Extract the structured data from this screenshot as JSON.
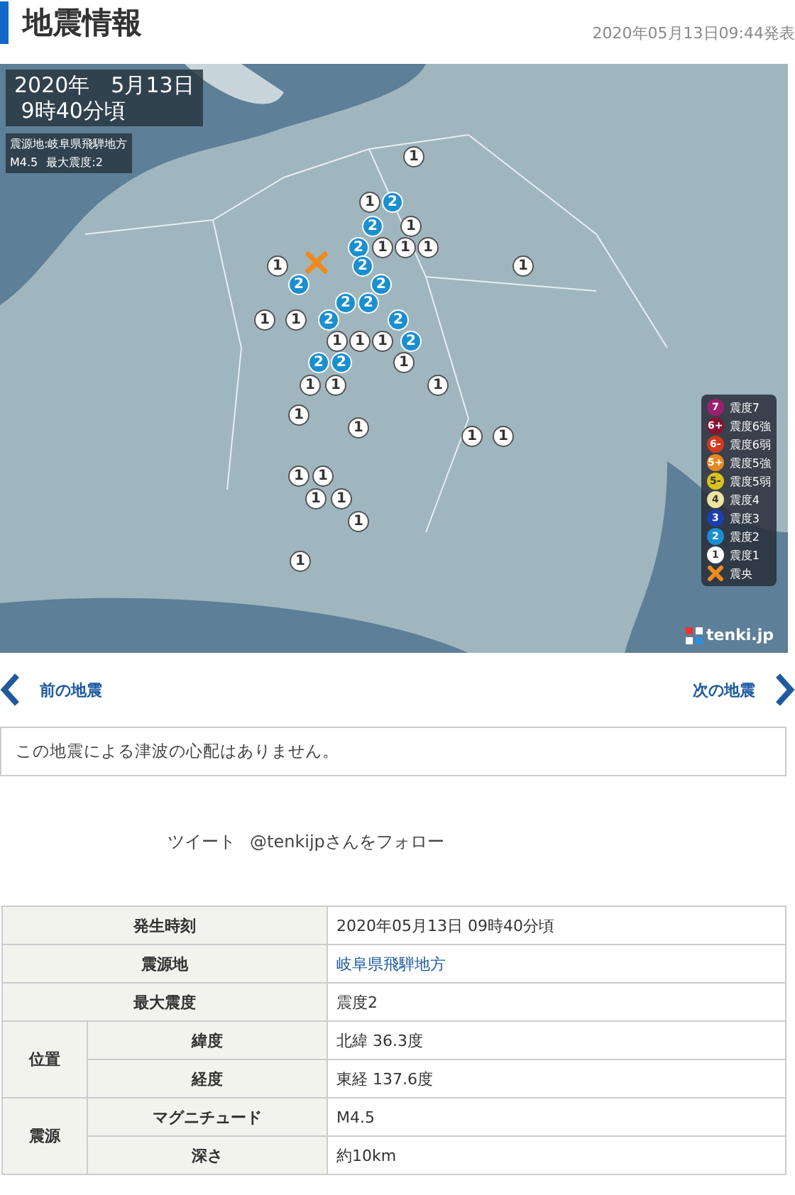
{
  "header": {
    "title": "地震情報",
    "published": "2020年05月13日09:44発表"
  },
  "map": {
    "date": "2020年　5月13日",
    "time": "9時40分頃",
    "epicenter_line": "震源地:岐阜県飛騨地方",
    "magnitude": "M4.5",
    "max_intensity": "最大震度:2",
    "markers": [
      {
        "label": "1",
        "color": "#ffffff"
      },
      {
        "label": "1",
        "color": "#ffffff"
      },
      {
        "label": "2",
        "color": "#1a8fd0"
      },
      {
        "label": "2",
        "color": "#1a8fd0"
      },
      {
        "label": "1",
        "color": "#ffffff"
      },
      {
        "label": "2",
        "color": "#1a8fd0"
      },
      {
        "label": "1",
        "color": "#ffffff"
      },
      {
        "label": "1",
        "color": "#ffffff"
      },
      {
        "label": "1",
        "color": "#ffffff"
      },
      {
        "label": "1",
        "color": "#ffffff"
      },
      {
        "label": "2",
        "color": "#1a8fd0"
      },
      {
        "label": "1",
        "color": "#ffffff"
      },
      {
        "label": "2",
        "color": "#1a8fd0"
      },
      {
        "label": "2",
        "color": "#1a8fd0"
      },
      {
        "label": "2",
        "color": "#1a8fd0"
      },
      {
        "label": "2",
        "color": "#1a8fd0"
      },
      {
        "label": "1",
        "color": "#ffffff"
      },
      {
        "label": "1",
        "color": "#ffffff"
      },
      {
        "label": "2",
        "color": "#1a8fd0"
      },
      {
        "label": "2",
        "color": "#1a8fd0"
      },
      {
        "label": "1",
        "color": "#ffffff"
      },
      {
        "label": "1",
        "color": "#ffffff"
      },
      {
        "label": "1",
        "color": "#ffffff"
      },
      {
        "label": "2",
        "color": "#1a8fd0"
      },
      {
        "label": "2",
        "color": "#1a8fd0"
      },
      {
        "label": "2",
        "color": "#1a8fd0"
      },
      {
        "label": "1",
        "color": "#ffffff"
      },
      {
        "label": "1",
        "color": "#ffffff"
      },
      {
        "label": "1",
        "color": "#ffffff"
      },
      {
        "label": "1",
        "color": "#ffffff"
      },
      {
        "label": "1",
        "color": "#ffffff"
      },
      {
        "label": "1",
        "color": "#ffffff"
      },
      {
        "label": "1",
        "color": "#ffffff"
      },
      {
        "label": "1",
        "color": "#ffffff"
      },
      {
        "label": "1",
        "color": "#ffffff"
      },
      {
        "label": "1",
        "color": "#ffffff"
      },
      {
        "label": "1",
        "color": "#ffffff"
      },
      {
        "label": "1",
        "color": "#ffffff"
      },
      {
        "label": "1",
        "color": "#ffffff"
      },
      {
        "label": "1",
        "color": "#ffffff"
      }
    ],
    "legend": [
      {
        "kind": "intensity",
        "symbol": "7",
        "label": "震度7",
        "color": "#9c1f6e"
      },
      {
        "kind": "intensity",
        "symbol": "6+",
        "label": "震度6強",
        "color": "#8a1230"
      },
      {
        "kind": "intensity",
        "symbol": "6-",
        "label": "震度6弱",
        "color": "#d03a1e"
      },
      {
        "kind": "intensity",
        "symbol": "5+",
        "label": "震度5強",
        "color": "#e38a1c"
      },
      {
        "kind": "intensity",
        "symbol": "5-",
        "label": "震度5弱",
        "color": "#d9c21e"
      },
      {
        "kind": "intensity",
        "symbol": "4",
        "label": "震度4",
        "color": "#efe3a0"
      },
      {
        "kind": "intensity",
        "symbol": "3",
        "label": "震度3",
        "color": "#1b3fb0"
      },
      {
        "kind": "intensity",
        "symbol": "2",
        "label": "震度2",
        "color": "#1a8fd0"
      },
      {
        "kind": "intensity",
        "symbol": "1",
        "label": "震度1",
        "color": "#ffffff"
      },
      {
        "kind": "epicenter",
        "label": "震央",
        "color": "#f08a1c"
      }
    ],
    "logo": "tenki.jp"
  },
  "nav": {
    "prev": "前の地震",
    "next": "次の地震"
  },
  "tsunami_notice": "この地震による津波の心配はありません。",
  "social": {
    "tweet": "ツイート",
    "follow": "@tenkijpさんをフォロー"
  },
  "table": {
    "rows": [
      {
        "kind": "single",
        "label": "発生時刻",
        "value": "2020年05月13日 09時40分頃",
        "link": false
      },
      {
        "kind": "single",
        "label": "震源地",
        "value": "岐阜県飛騨地方",
        "link": true
      },
      {
        "kind": "single",
        "label": "最大震度",
        "value": "震度2",
        "link": false
      },
      {
        "kind": "group",
        "label": "位置",
        "items": [
          {
            "label": "緯度",
            "value": "北緯 36.3度"
          },
          {
            "label": "経度",
            "value": "東経 137.6度"
          }
        ]
      },
      {
        "kind": "group",
        "label": "震源",
        "items": [
          {
            "label": "マグニチュード",
            "value": "M4.5"
          },
          {
            "label": "深さ",
            "value": "約10km"
          }
        ]
      }
    ]
  }
}
